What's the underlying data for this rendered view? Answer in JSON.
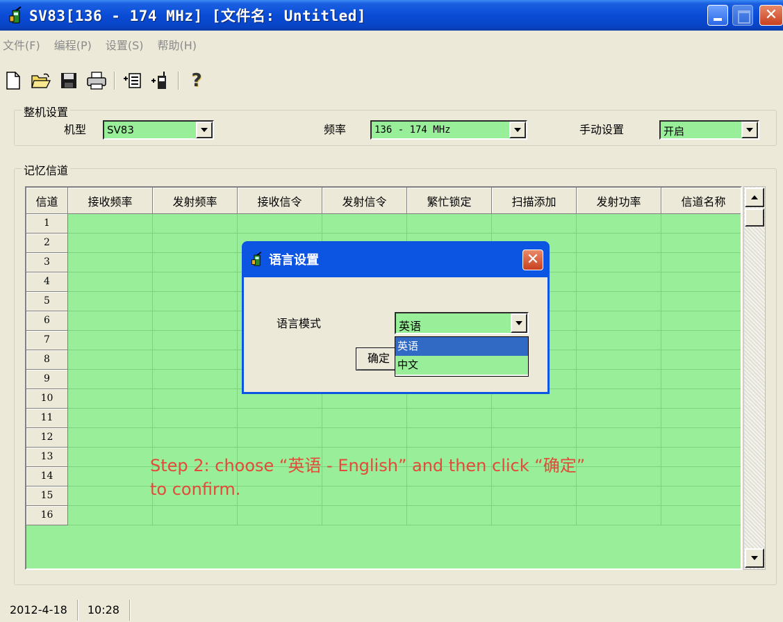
{
  "window": {
    "title": "SV83[136 - 174 MHz] [文件名: Untitled]",
    "close_glyph": "✕"
  },
  "menu": [
    "文件(F)",
    "编程(P)",
    "设置(S)",
    "帮助(H)"
  ],
  "toolbar": {
    "icons": [
      "new-file-icon",
      "open-folder-icon",
      "save-disk-icon",
      "print-icon",
      "read-from-radio-icon",
      "write-to-radio-icon",
      "help-icon"
    ],
    "help_glyph": "?"
  },
  "machine_settings": {
    "legend": "整机设置",
    "model_label": "机型",
    "model_value": "SV83",
    "freq_label": "频率",
    "freq_value": "136 - 174 MHz",
    "manual_label": "手动设置",
    "manual_value": "开启"
  },
  "memory_channels": {
    "legend": "记忆信道",
    "columns": [
      "信道",
      "接收频率",
      "发射频率",
      "接收信令",
      "发射信令",
      "繁忙锁定",
      "扫描添加",
      "发射功率",
      "信道名称"
    ],
    "rows": [
      "1",
      "2",
      "3",
      "4",
      "5",
      "6",
      "7",
      "8",
      "9",
      "10",
      "11",
      "12",
      "13",
      "14",
      "15",
      "16"
    ]
  },
  "dialog": {
    "title": "语言设置",
    "mode_label": "语言模式",
    "selected": "英语",
    "options": [
      "英语",
      "中文"
    ],
    "ok_label": "确定",
    "close_glyph": "✕"
  },
  "annotation": {
    "line1": "Step 2: choose “英语 - English” and then click “确定”",
    "line2": "to confirm."
  },
  "status": {
    "date": "2012-4-18",
    "time": "10:28"
  },
  "colors": {
    "grid_green": "#99ee99",
    "titlebar_blue": "#0a4cd6",
    "annotation_red": "#e24b3a",
    "selection_blue": "#316ac5"
  }
}
